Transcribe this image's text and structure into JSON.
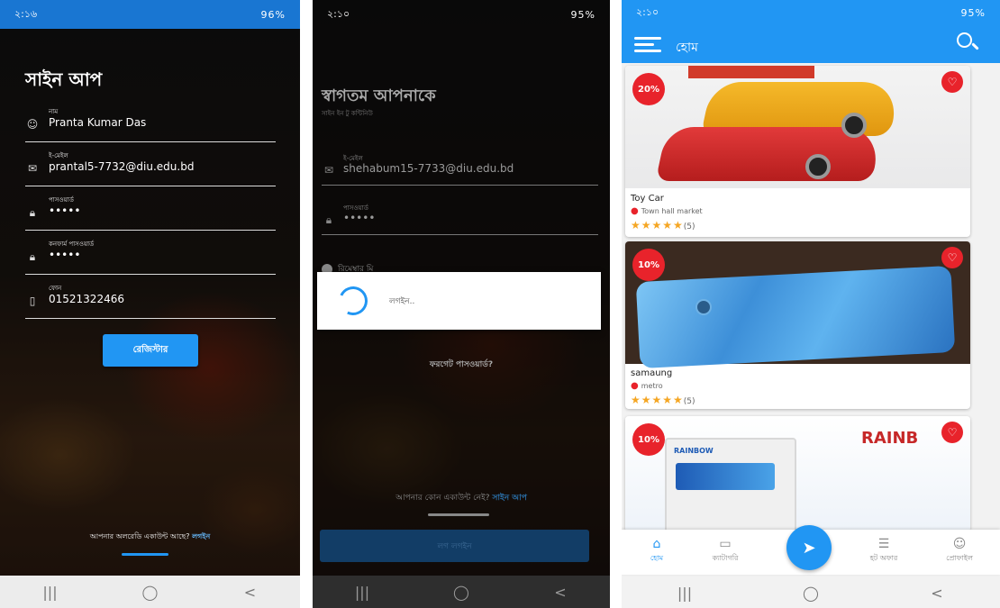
{
  "signup": {
    "status": {
      "time": "২:১৬",
      "battery": "96%"
    },
    "title": "সাইন আপ",
    "fields": [
      {
        "label": "নাম",
        "value": "Pranta Kumar Das",
        "icon": "user-icon"
      },
      {
        "label": "ই-মেইল",
        "value": "prantal5-7732@diu.edu.bd",
        "icon": "mail-icon"
      },
      {
        "label": "পাসওয়ার্ড",
        "value": "•••••",
        "icon": "lock-icon"
      },
      {
        "label": "কনফার্ম পাসওয়ার্ড",
        "value": "•••••",
        "icon": "lock-icon"
      },
      {
        "label": "ফোন",
        "value": "01521322466",
        "icon": "phone-icon"
      }
    ],
    "register_label": "রেজিস্টার",
    "have_account": "আপনার অলরেডি একাউন্ট আছে?",
    "login_link": "লগইন"
  },
  "login": {
    "status": {
      "time": "২:১০",
      "battery": "95%"
    },
    "title": "স্বাগতম আপনাকে",
    "subtitle": "সাইন ইন টু কন্টিনিউ",
    "email": {
      "label": "ই-মেইল",
      "value": "shehabum15-7733@diu.edu.bd"
    },
    "password": {
      "label": "পাসওয়ার্ড",
      "value": "•••••"
    },
    "remember_label": "রিমেম্বার মি",
    "dialog_text": "লগইন..",
    "forgot_label": "ফরগেট পাসওয়ার্ড?",
    "no_account": "আপনার কোন একাউন্ট নেই?",
    "signup_link": "সাইন আপ",
    "login_button": "লগ লগইন"
  },
  "home": {
    "status": {
      "time": "২:১০",
      "battery": "95%"
    },
    "title": "হোম",
    "products": [
      {
        "name": "Toy Car",
        "location": "Town hall market",
        "discount": "20%",
        "stars": "★★★★★",
        "reviews": "(5)"
      },
      {
        "name": "samaung",
        "location": "metro",
        "discount": "10%",
        "stars": "★★★★★",
        "reviews": "(5)"
      },
      {
        "name": "",
        "location": "",
        "discount": "10%",
        "stars": "",
        "reviews": ""
      }
    ],
    "paint_logo": "RAINB",
    "paint_brand": "RAINBOW",
    "bottom_nav": [
      {
        "label": "হোম",
        "icon": "home-icon"
      },
      {
        "label": "ক্যাটাগরি",
        "icon": "category-icon"
      },
      {
        "label": "হট অফার",
        "icon": "hot-offer-icon"
      },
      {
        "label": "প্রোফাইল",
        "icon": "profile-icon"
      }
    ]
  },
  "system_nav": {
    "recents": "|||",
    "home": "◯",
    "back": "<"
  },
  "colors": {
    "primary": "#2196f3",
    "accent_red": "#e8232b",
    "star": "#f5a623"
  }
}
